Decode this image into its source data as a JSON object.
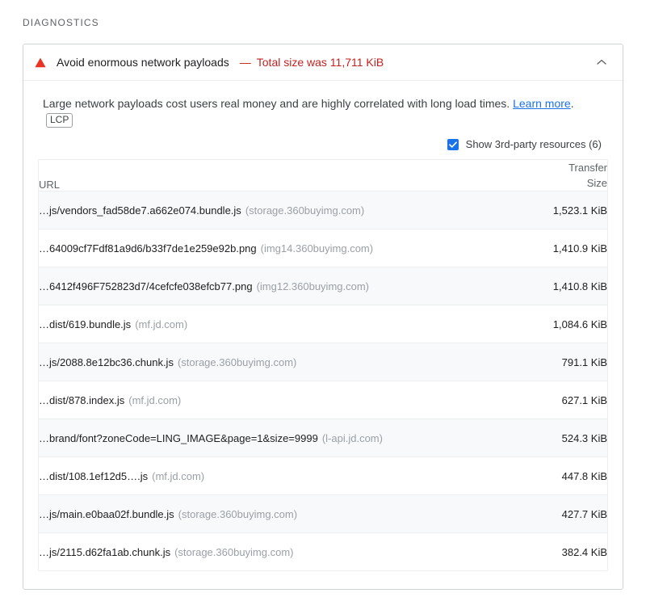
{
  "section": {
    "heading": "DIAGNOSTICS"
  },
  "audit": {
    "icon": "warning-triangle-icon",
    "title": "Avoid enormous network payloads",
    "separator": "—",
    "value": "Total size was 11,711 KiB",
    "collapse_icon": "chevron-up-icon",
    "description_before": "Large network payloads cost users real money and are highly correlated with long load times.",
    "learn_more_label": "Learn more",
    "description_after": ".",
    "metric_badge": "LCP",
    "accent_color": "#c5221f",
    "link_color": "#1a73e8"
  },
  "filter": {
    "checked": true,
    "label": "Show 3rd-party resources (6)",
    "checkbox_color": "#1a73e8",
    "check_icon": "checkmark-icon"
  },
  "table": {
    "columns": {
      "url": "URL",
      "size_line1": "Transfer",
      "size_line2": "Size"
    },
    "rows": [
      {
        "url": "…js/vendors_fad58de7.a662e074.bundle.js",
        "origin": "(storage.360buyimg.com)",
        "size": "1,523.1 KiB"
      },
      {
        "url": "…64009cf7Fdf81a9d6/b33f7de1e259e92b.png",
        "origin": "(img14.360buyimg.com)",
        "size": "1,410.9 KiB"
      },
      {
        "url": "…6412f496F752823d7/4cefcfe038efcb77.png",
        "origin": "(img12.360buyimg.com)",
        "size": "1,410.8 KiB"
      },
      {
        "url": "…dist/619.bundle.js",
        "origin": "(mf.jd.com)",
        "size": "1,084.6 KiB"
      },
      {
        "url": "…js/2088.8e12bc36.chunk.js",
        "origin": "(storage.360buyimg.com)",
        "size": "791.1 KiB"
      },
      {
        "url": "…dist/878.index.js",
        "origin": "(mf.jd.com)",
        "size": "627.1 KiB"
      },
      {
        "url": "…brand/font?zoneCode=LING_IMAGE&page=1&size=9999",
        "origin": "(l-api.jd.com)",
        "size": "524.3 KiB"
      },
      {
        "url": "…dist/108.1ef12d5….js",
        "origin": "(mf.jd.com)",
        "size": "447.8 KiB"
      },
      {
        "url": "…js/main.e0baa02f.bundle.js",
        "origin": "(storage.360buyimg.com)",
        "size": "427.7 KiB"
      },
      {
        "url": "…js/2115.d62fa1ab.chunk.js",
        "origin": "(storage.360buyimg.com)",
        "size": "382.4 KiB"
      }
    ]
  }
}
